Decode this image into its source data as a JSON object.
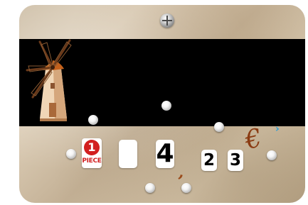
{
  "coin_slot": {
    "number": "1",
    "label": "PIECE"
  },
  "price_display": {
    "digit_1": "",
    "digit_2": "4",
    "separator": ",",
    "digit_3": "2",
    "digit_4": "3",
    "currency": "€"
  },
  "indicator": {
    "glyph": "›"
  },
  "icons": [
    "windmill-icon",
    "top-screw-icon",
    "screw-icon"
  ],
  "colors": {
    "panel": "#cbbba2",
    "band": "#000000",
    "coin_red": "#d21f1f",
    "currency_brown": "#8a3b12",
    "indicator_blue": "#2a9fd6"
  }
}
